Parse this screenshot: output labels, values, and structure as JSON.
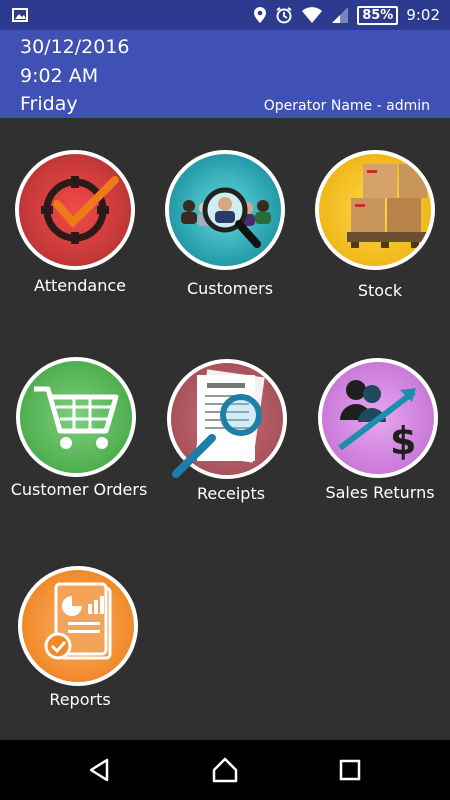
{
  "status_bar": {
    "battery": "85%",
    "time": "9:02",
    "icons": [
      "gallery-icon",
      "location-icon",
      "alarm-icon",
      "wifi-icon",
      "signal-icon",
      "battery-icon"
    ]
  },
  "header": {
    "date": "30/12/2016",
    "time": "9:02 AM",
    "day": "Friday",
    "operator": "Operator Name - admin"
  },
  "tiles": [
    {
      "label": "Attendance",
      "icon": "attendance-icon"
    },
    {
      "label": "Customers",
      "icon": "customers-icon"
    },
    {
      "label": "Stock",
      "icon": "stock-icon"
    },
    {
      "label": "Customer Orders",
      "icon": "cart-icon"
    },
    {
      "label": "Receipts",
      "icon": "receipt-icon"
    },
    {
      "label": "Sales Returns",
      "icon": "sales-returns-icon"
    },
    {
      "label": "Reports",
      "icon": "reports-icon"
    }
  ],
  "navbar": {
    "buttons": [
      "back-icon",
      "home-icon",
      "recents-icon"
    ]
  },
  "colors": {
    "header": "#3f51b5",
    "statusbar": "#2c3a8f",
    "background": "#303030"
  }
}
